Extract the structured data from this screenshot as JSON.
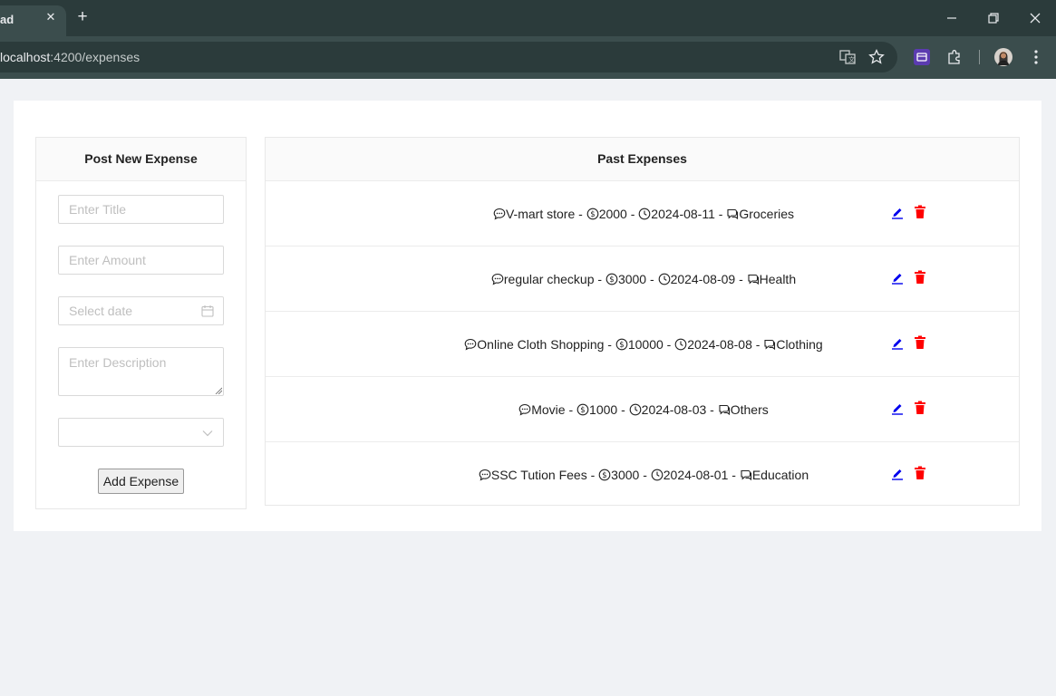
{
  "browser": {
    "tab_title": "ad",
    "url_host": "localhost",
    "url_path": ":4200/expenses"
  },
  "form": {
    "heading": "Post New Expense",
    "title_placeholder": "Enter Title",
    "amount_placeholder": "Enter Amount",
    "date_placeholder": "Select date",
    "description_placeholder": "Enter Description",
    "category_value": "",
    "submit_label": "Add Expense"
  },
  "expenses": {
    "heading": "Past Expenses",
    "rows": [
      {
        "title": "V-mart store",
        "amount": "2000",
        "date": "2024-08-11",
        "category": "Groceries"
      },
      {
        "title": "regular checkup",
        "amount": "3000",
        "date": "2024-08-09",
        "category": "Health"
      },
      {
        "title": "Online Cloth Shopping",
        "amount": "10000",
        "date": "2024-08-08",
        "category": "Clothing"
      },
      {
        "title": "Movie",
        "amount": "1000",
        "date": "2024-08-03",
        "category": "Others"
      },
      {
        "title": "SSC Tution Fees",
        "amount": "3000",
        "date": "2024-08-01",
        "category": "Education"
      }
    ],
    "separator": " - ",
    "edit_color": "#0000ee",
    "delete_color": "#ff0000"
  }
}
